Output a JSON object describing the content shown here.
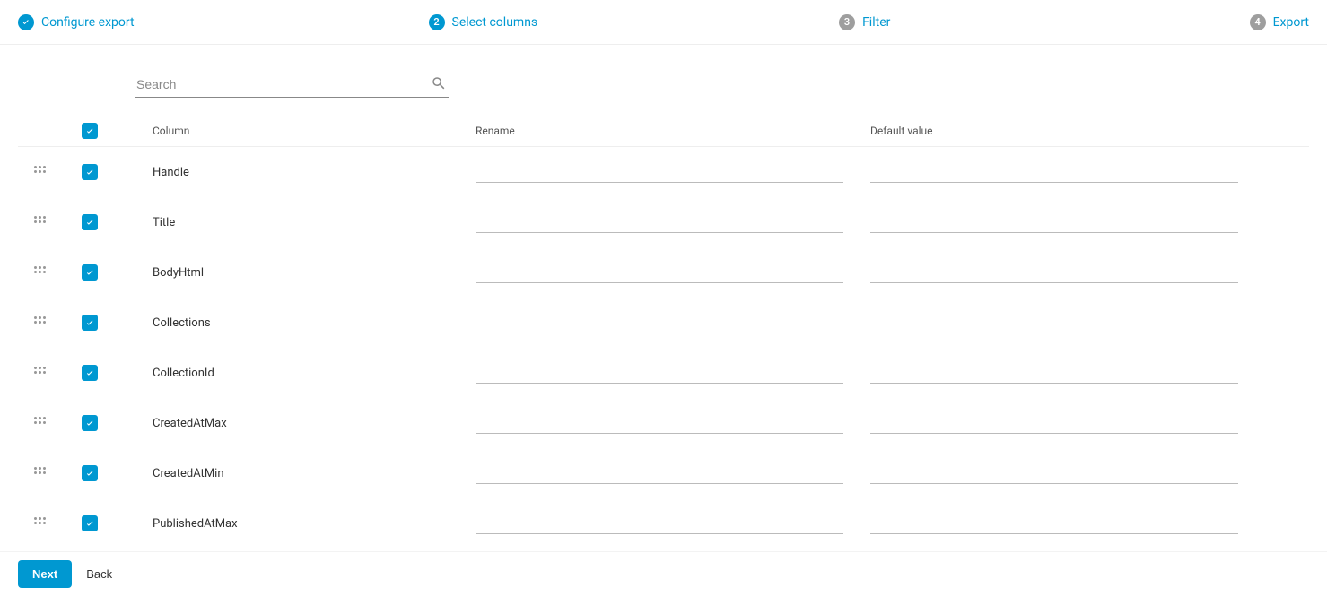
{
  "stepper": {
    "steps": [
      {
        "label": "Configure export",
        "state": "done"
      },
      {
        "label": "Select columns",
        "state": "current",
        "number": "2"
      },
      {
        "label": "Filter",
        "state": "pending",
        "number": "3"
      },
      {
        "label": "Export",
        "state": "pending",
        "number": "4"
      }
    ]
  },
  "search": {
    "placeholder": "Search",
    "value": ""
  },
  "table": {
    "headers": {
      "column": "Column",
      "rename": "Rename",
      "default_value": "Default value"
    },
    "rows": [
      {
        "name": "Handle",
        "checked": true,
        "rename": "",
        "default": ""
      },
      {
        "name": "Title",
        "checked": true,
        "rename": "",
        "default": ""
      },
      {
        "name": "BodyHtml",
        "checked": true,
        "rename": "",
        "default": ""
      },
      {
        "name": "Collections",
        "checked": true,
        "rename": "",
        "default": ""
      },
      {
        "name": "CollectionId",
        "checked": true,
        "rename": "",
        "default": ""
      },
      {
        "name": "CreatedAtMax",
        "checked": true,
        "rename": "",
        "default": ""
      },
      {
        "name": "CreatedAtMin",
        "checked": true,
        "rename": "",
        "default": ""
      },
      {
        "name": "PublishedAtMax",
        "checked": true,
        "rename": "",
        "default": ""
      }
    ]
  },
  "footer": {
    "next_label": "Next",
    "back_label": "Back"
  },
  "colors": {
    "accent": "#0098d1",
    "muted": "#9e9e9e"
  }
}
